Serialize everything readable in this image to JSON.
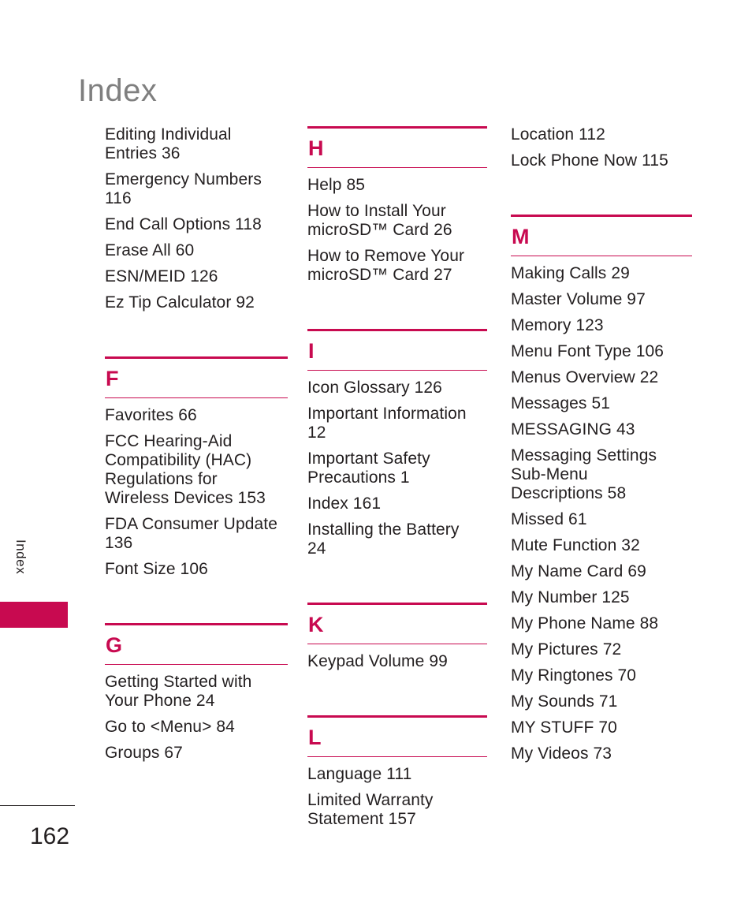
{
  "page": {
    "title": "Index",
    "side_tab_label": "Index",
    "page_number": "162",
    "accent_color": "#c80a50",
    "title_color": "#7f7f7f",
    "text_color": "#231f20"
  },
  "columns": [
    {
      "id": "column-1",
      "blocks": [
        {
          "type": "entries",
          "entries": [
            {
              "lines": [
                "Editing Individual",
                "Entries 36"
              ]
            },
            {
              "lines": [
                "Emergency Numbers",
                "116"
              ]
            },
            {
              "lines": [
                "End Call Options 118"
              ]
            },
            {
              "lines": [
                "Erase All 60"
              ]
            },
            {
              "lines": [
                "ESN/MEID 126"
              ]
            },
            {
              "lines": [
                "Ez Tip Calculator 92"
              ]
            }
          ]
        },
        {
          "type": "section",
          "letter": "F",
          "entries": [
            {
              "lines": [
                "Favorites 66"
              ]
            },
            {
              "lines": [
                "FCC Hearing-Aid",
                "Compatibility (HAC)",
                "Regulations for",
                "Wireless Devices 153"
              ]
            },
            {
              "lines": [
                "FDA Consumer Update",
                "136"
              ]
            },
            {
              "lines": [
                "Font Size 106"
              ]
            }
          ]
        },
        {
          "type": "section",
          "letter": "G",
          "entries": [
            {
              "lines": [
                "Getting Started with",
                "Your Phone 24"
              ]
            },
            {
              "lines": [
                "Go to <Menu> 84"
              ]
            },
            {
              "lines": [
                "Groups 67"
              ]
            }
          ]
        }
      ]
    },
    {
      "id": "column-2",
      "blocks": [
        {
          "type": "section",
          "letter": "H",
          "entries": [
            {
              "lines": [
                "Help 85"
              ]
            },
            {
              "lines": [
                "How to Install Your",
                "microSD™ Card 26"
              ]
            },
            {
              "lines": [
                "How to Remove Your",
                "microSD™ Card 27"
              ]
            }
          ]
        },
        {
          "type": "section",
          "letter": "I",
          "entries": [
            {
              "lines": [
                "Icon Glossary 126"
              ]
            },
            {
              "lines": [
                "Important Information",
                "12"
              ]
            },
            {
              "lines": [
                "Important Safety",
                "Precautions 1"
              ]
            },
            {
              "lines": [
                "Index 161"
              ]
            },
            {
              "lines": [
                "Installing the Battery",
                "24"
              ]
            }
          ]
        },
        {
          "type": "section",
          "letter": "K",
          "entries": [
            {
              "lines": [
                "Keypad Volume 99"
              ]
            }
          ]
        },
        {
          "type": "section",
          "letter": "L",
          "entries": [
            {
              "lines": [
                "Language 111"
              ]
            },
            {
              "lines": [
                "Limited Warranty",
                "Statement 157"
              ]
            }
          ]
        }
      ]
    },
    {
      "id": "column-3",
      "blocks": [
        {
          "type": "entries",
          "entries": [
            {
              "lines": [
                "Location 112"
              ]
            },
            {
              "lines": [
                "Lock Phone Now 115"
              ]
            }
          ]
        },
        {
          "type": "section",
          "letter": "M",
          "entries": [
            {
              "lines": [
                "Making Calls 29"
              ]
            },
            {
              "lines": [
                "Master Volume 97"
              ]
            },
            {
              "lines": [
                "Memory 123"
              ]
            },
            {
              "lines": [
                "Menu Font Type 106"
              ]
            },
            {
              "lines": [
                "Menus Overview 22"
              ]
            },
            {
              "lines": [
                "Messages 51"
              ]
            },
            {
              "lines": [
                "MESSAGING 43"
              ]
            },
            {
              "lines": [
                "Messaging Settings",
                "Sub-Menu",
                "Descriptions 58"
              ]
            },
            {
              "lines": [
                "Missed 61"
              ]
            },
            {
              "lines": [
                "Mute Function 32"
              ]
            },
            {
              "lines": [
                "My Name Card 69"
              ]
            },
            {
              "lines": [
                "My Number 125"
              ]
            },
            {
              "lines": [
                "My Phone Name 88"
              ]
            },
            {
              "lines": [
                "My Pictures 72"
              ]
            },
            {
              "lines": [
                "My Ringtones 70"
              ]
            },
            {
              "lines": [
                "My Sounds 71"
              ]
            },
            {
              "lines": [
                "MY STUFF 70"
              ]
            },
            {
              "lines": [
                "My Videos 73"
              ]
            }
          ]
        }
      ]
    }
  ]
}
